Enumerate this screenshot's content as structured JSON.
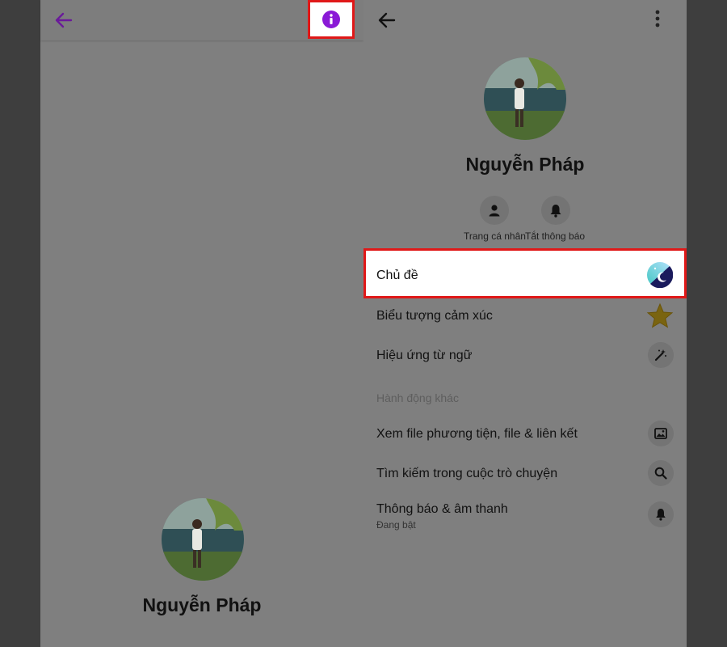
{
  "colors": {
    "accent": "#8a1ad6",
    "highlight_border": "#e01818",
    "overlay": "#7f7f7f"
  },
  "left_screen": {
    "back_icon": "arrow-left-icon",
    "info_icon": "info-circle-icon",
    "profile_name": "Nguyễn Pháp"
  },
  "right_screen": {
    "back_icon": "arrow-left-icon",
    "more_icon": "more-vertical-icon",
    "profile_name": "Nguyễn Pháp",
    "actions": [
      {
        "label": "Trang cá nhân",
        "icon": "person-icon"
      },
      {
        "label": "Tắt thông báo",
        "icon": "bell-icon"
      }
    ],
    "customize": [
      {
        "label": "Chủ đề",
        "icon": "theme-icon"
      },
      {
        "label": "Biểu tượng cảm xúc",
        "icon": "star-icon"
      },
      {
        "label": "Hiệu ứng từ ngữ",
        "icon": "magic-wand-icon"
      }
    ],
    "more_actions_title": "Hành động khác",
    "more_actions": [
      {
        "label": "Xem file phương tiện, file & liên kết",
        "icon": "image-icon"
      },
      {
        "label": "Tìm kiếm trong cuộc trò chuyện",
        "icon": "search-icon"
      },
      {
        "label": "Thông báo & âm thanh",
        "sublabel": "Đang bật",
        "icon": "bell-icon"
      }
    ]
  }
}
